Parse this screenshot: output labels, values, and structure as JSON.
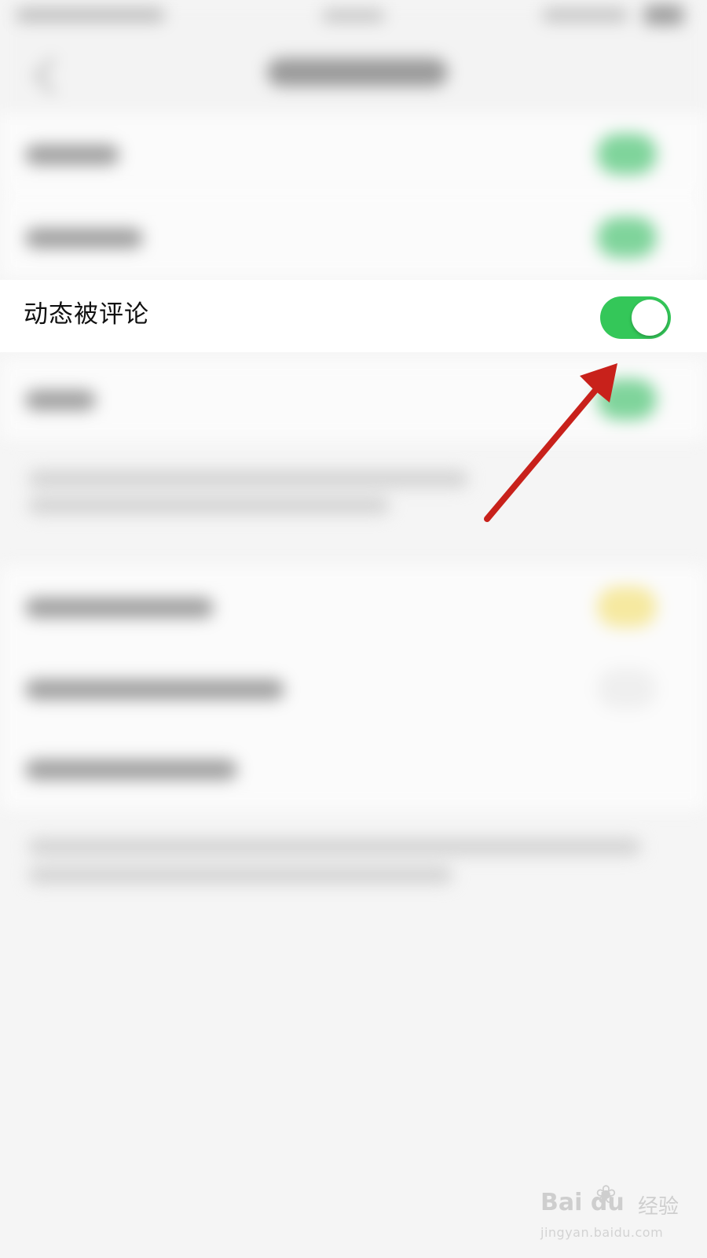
{
  "settings": {
    "highlighted_row": {
      "label": "动态被评论",
      "toggle_on": true
    }
  },
  "colors": {
    "toggle_on": "#34c759",
    "annotation_arrow": "#c8211b",
    "background": "#f5f5f5"
  },
  "watermark": {
    "logo": "Bai du",
    "cn": "经验",
    "url": "jingyan.baidu.com"
  },
  "icons": {
    "back": "chevron-left-icon",
    "annotation": "red-arrow"
  }
}
